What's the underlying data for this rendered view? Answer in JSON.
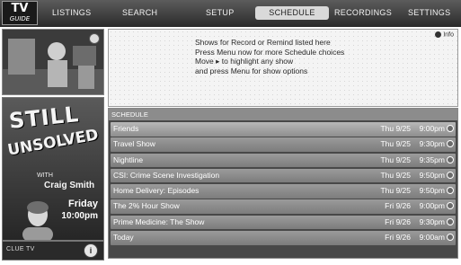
{
  "logo": {
    "main": "TV",
    "sub": "GUIDE"
  },
  "nav": {
    "tabs": [
      {
        "label": "Listings"
      },
      {
        "label": "Search"
      },
      {
        "label": "Setup"
      },
      {
        "label": "Schedule"
      },
      {
        "label": "Recordings"
      },
      {
        "label": "Settings"
      }
    ],
    "active_index": 3
  },
  "promo": {
    "line1": "STILL",
    "line2": "UNSOLVED",
    "with": "WITH",
    "host": "Craig Smith",
    "day": "Friday",
    "time": "10:00pm",
    "channel_logo": "CLUE TV"
  },
  "info_panel": {
    "lines": [
      "Shows for Record or Remind listed here",
      "Press Menu now for more Schedule choices",
      "Move ▸ to highlight any show",
      "and press Menu for show options"
    ],
    "icon_label": "Info"
  },
  "schedule": {
    "header": "Schedule",
    "rows": [
      {
        "title": "Friends",
        "date": "Thu 9/25",
        "time": "9:00pm"
      },
      {
        "title": "Travel Show",
        "date": "Thu 9/25",
        "time": "9:30pm"
      },
      {
        "title": "Nightline",
        "date": "Thu 9/25",
        "time": "9:35pm"
      },
      {
        "title": "CSI: Crime Scene Investigation",
        "date": "Thu 9/25",
        "time": "9:50pm"
      },
      {
        "title": "Home Delivery: Episodes",
        "date": "Thu 9/25",
        "time": "9:50pm"
      },
      {
        "title": "The 2% Hour Show",
        "date": "Fri 9/26",
        "time": "9:00pm"
      },
      {
        "title": "Prime Medicine: The Show",
        "date": "Fri 9/26",
        "time": "9:30pm"
      },
      {
        "title": "Today",
        "date": "Fri 9/26",
        "time": "9:00am"
      }
    ]
  },
  "colors": {
    "nav_bar": "#3a3a3a",
    "active_tab": "#d9d9d9",
    "schedule_bg": "#484848",
    "row": "#8c8c8c",
    "info_bg": "#f4f4f4"
  }
}
